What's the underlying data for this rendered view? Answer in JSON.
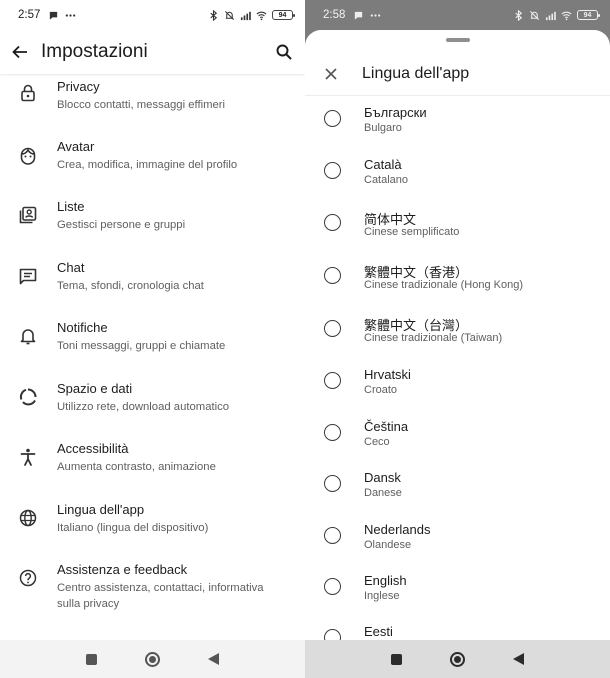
{
  "left": {
    "status": {
      "time": "2:57",
      "battery": "94"
    },
    "appbar": {
      "title": "Impostazioni"
    },
    "settings": [
      {
        "title": "Privacy",
        "subtitle": "Blocco contatti, messaggi effimeri",
        "icon": "lock-icon"
      },
      {
        "title": "Avatar",
        "subtitle": "Crea, modifica, immagine del profilo",
        "icon": "avatar-face-icon"
      },
      {
        "title": "Liste",
        "subtitle": "Gestisci persone e gruppi",
        "icon": "contact-list-icon"
      },
      {
        "title": "Chat",
        "subtitle": "Tema, sfondi, cronologia chat",
        "icon": "chat-icon"
      },
      {
        "title": "Notifiche",
        "subtitle": "Toni messaggi, gruppi e chiamate",
        "icon": "bell-icon"
      },
      {
        "title": "Spazio e dati",
        "subtitle": "Utilizzo rete, download automatico",
        "icon": "storage-circle-icon"
      },
      {
        "title": "Accessibilità",
        "subtitle": "Aumenta contrasto, animazione",
        "icon": "accessibility-icon"
      },
      {
        "title": "Lingua dell'app",
        "subtitle": "Italiano (lingua del dispositivo)",
        "icon": "globe-icon"
      },
      {
        "title": "Assistenza e feedback",
        "subtitle": "Centro assistenza, contattaci, informativa sulla privacy",
        "icon": "help-icon"
      }
    ]
  },
  "right": {
    "status": {
      "time": "2:58",
      "battery": "94"
    },
    "sheet": {
      "title": "Lingua dell'app"
    },
    "languages": [
      {
        "name": "Български",
        "sub": "Bulgaro"
      },
      {
        "name": "Català",
        "sub": "Catalano"
      },
      {
        "name": "简体中文",
        "sub": "Cinese semplificato"
      },
      {
        "name": "繁體中文（香港）",
        "sub": "Cinese tradizionale (Hong Kong)"
      },
      {
        "name": "繁體中文（台灣）",
        "sub": "Cinese tradizionale (Taiwan)"
      },
      {
        "name": "Hrvatski",
        "sub": "Croato"
      },
      {
        "name": "Čeština",
        "sub": "Ceco"
      },
      {
        "name": "Dansk",
        "sub": "Danese"
      },
      {
        "name": "Nederlands",
        "sub": "Olandese"
      },
      {
        "name": "English",
        "sub": "Inglese"
      },
      {
        "name": "Eesti",
        "sub": ""
      }
    ]
  }
}
